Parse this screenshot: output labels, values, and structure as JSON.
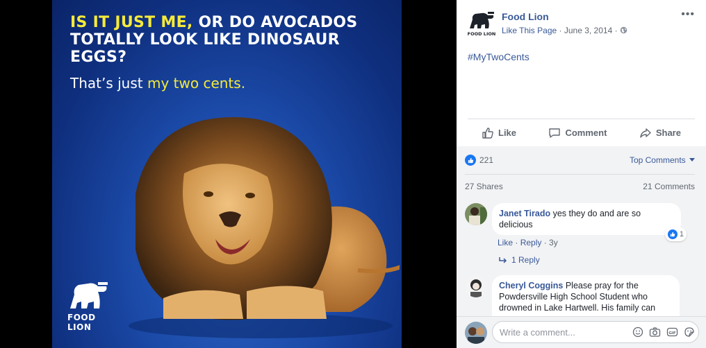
{
  "photo": {
    "headline_part1": "IS IT JUST ME,",
    "headline_part2": " OR DO AVOCADOS TOTALLY LOOK LIKE DINOSAUR EGGS?",
    "tagline_part1": "That’s just ",
    "tagline_part2": "my two cents.",
    "logo_text": "FOOD LION"
  },
  "post": {
    "page_name": "Food Lion",
    "logo_text": "FOOD LION",
    "like_page": "Like This Page",
    "separator": " · ",
    "date": "June 3, 2014",
    "more": "•••",
    "hashtag": "#MyTwoCents"
  },
  "actions": {
    "like": "Like",
    "comment": "Comment",
    "share": "Share"
  },
  "stats": {
    "reactions_count": "221",
    "top_comments": "Top Comments",
    "shares": "27 Shares",
    "comments": "21 Comments"
  },
  "comments": [
    {
      "author": "Janet Tirado",
      "text": " yes they do and are so delicious",
      "like": "Like",
      "reply": "Reply",
      "age": "3y",
      "dot": " · ",
      "reactions": "1",
      "replies": "1 Reply"
    },
    {
      "author": "Cheryl Coggins",
      "text": " Please pray for the Powdersville High School Student who drowned in Lake Hartwell. His family can"
    }
  ],
  "composer": {
    "placeholder": "Write a comment..."
  },
  "colors": {
    "link_blue": "#385898",
    "facebook_blue": "#1877f2",
    "headline_yellow": "#f5ea3b",
    "photo_blue": "#1b4aa8"
  },
  "icons": [
    "lion-logo",
    "globe-icon",
    "more-icon",
    "like-icon",
    "comment-icon",
    "share-icon",
    "caret-down-icon",
    "reply-arrow-icon",
    "emoji-icon",
    "camera-icon",
    "gif-icon",
    "sticker-icon"
  ]
}
